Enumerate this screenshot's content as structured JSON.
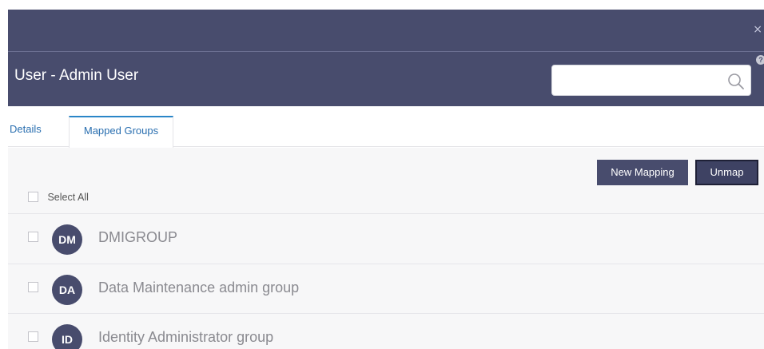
{
  "header": {
    "close_symbol": "×",
    "title": "User - Admin User",
    "help_symbol": "?",
    "search": {
      "value": "",
      "placeholder": ""
    }
  },
  "tabs": [
    {
      "label": "Details",
      "active": false
    },
    {
      "label": "Mapped Groups",
      "active": true
    }
  ],
  "toolbar": {
    "new_mapping_label": "New Mapping",
    "unmap_label": "Unmap"
  },
  "list": {
    "select_all_label": "Select All",
    "groups": [
      {
        "initials": "DM",
        "name": "DMIGROUP",
        "checked": false
      },
      {
        "initials": "DA",
        "name": "Data Maintenance admin group",
        "checked": false
      },
      {
        "initials": "ID",
        "name": "Identity Administrator group",
        "checked": false
      }
    ]
  },
  "colors": {
    "header_bg": "#484c6d",
    "tab_accent": "#2a86c8",
    "button_bg": "#484c6d",
    "avatar_bg": "#484c6d"
  },
  "icons": {
    "close": "close-icon",
    "help": "help-icon",
    "search": "search-icon",
    "checkbox": "checkbox-icon"
  }
}
